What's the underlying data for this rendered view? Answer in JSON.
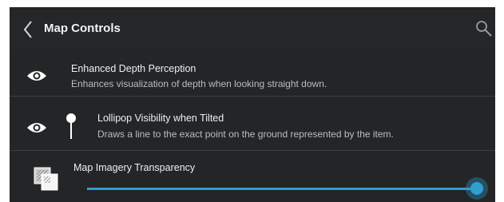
{
  "header": {
    "title": "Map Controls",
    "back_icon": "chevron-left-icon",
    "search_icon": "search-icon"
  },
  "settings": {
    "enhanced_depth": {
      "label": "Enhanced Depth Perception",
      "description": "Enhances visualization of depth when looking straight down.",
      "icon": "eye-icon"
    },
    "lollipop": {
      "label": "Lollipop Visibility when Tilted",
      "description": "Draws a line to the exact point on the ground represented by the item.",
      "icons": [
        "eye-icon",
        "lollipop-icon"
      ]
    },
    "transparency": {
      "label": "Map Imagery Transparency",
      "icon": "layers-icon",
      "slider_value": 1.0
    }
  },
  "colors": {
    "background": "#232527",
    "accent": "#2f9fd0",
    "divider": "#3c3e41"
  }
}
